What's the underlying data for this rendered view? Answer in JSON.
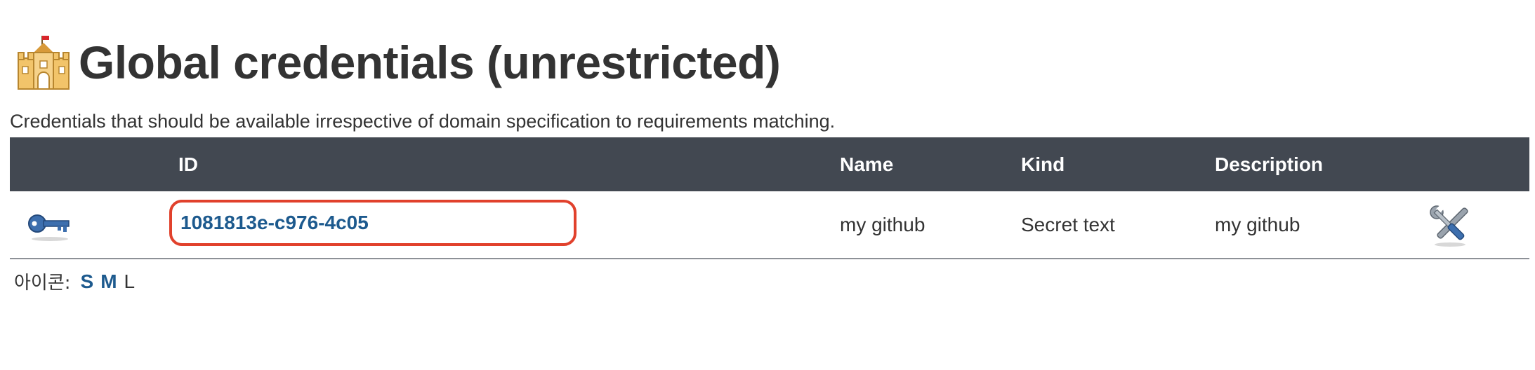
{
  "page": {
    "title": "Global credentials (unrestricted)",
    "description": "Credentials that should be available irrespective of domain specification to requirements matching."
  },
  "table": {
    "headers": {
      "icon": "",
      "id": "ID",
      "name": "Name",
      "kind": "Kind",
      "description": "Description"
    },
    "rows": [
      {
        "icon": "key-icon",
        "id": "1081813e-c976-4c05",
        "name": "my github",
        "kind": "Secret text",
        "description": "my github",
        "action_icon": "wrench-screwdriver-icon"
      }
    ]
  },
  "icon_size": {
    "label": "아이콘:",
    "small": "S",
    "medium": "M",
    "large": "L"
  },
  "colors": {
    "header_bg": "#424851",
    "link": "#1d5a8e",
    "highlight_border": "#e1412c"
  }
}
